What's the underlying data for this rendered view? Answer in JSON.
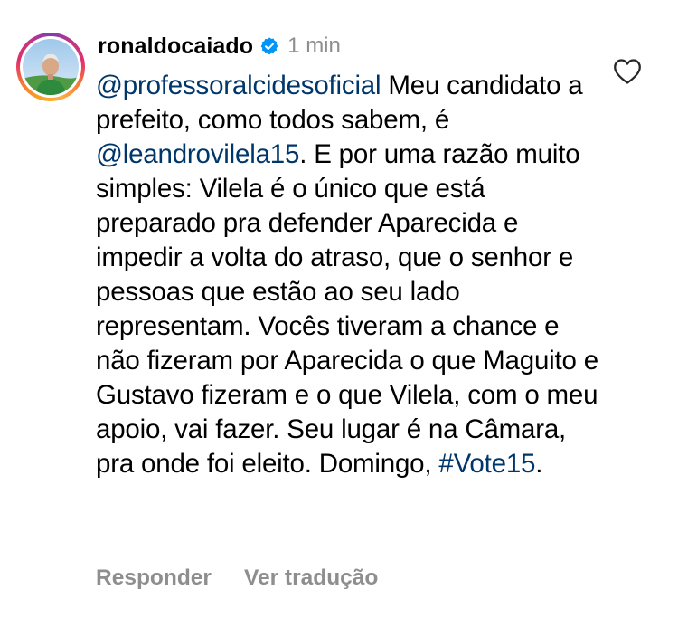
{
  "comment": {
    "username": "ronaldocaiado",
    "verified_icon": "verified-badge-icon",
    "timestamp": "1 min",
    "segments": [
      {
        "type": "mention",
        "text": "@professoralcidesoficial"
      },
      {
        "type": "text",
        "text": " Meu candidato a prefeito, como todos sabem, é "
      },
      {
        "type": "mention",
        "text": "@leandrovilela15"
      },
      {
        "type": "text",
        "text": ". E por uma razão muito simples: Vilela é o único que está preparado pra defender Aparecida e impedir a volta do atraso, que o senhor e pessoas que estão ao seu lado representam. Vocês tiveram a chance e não fizeram por Aparecida o que Maguito e Gustavo fizeram e o que Vilela, com o meu apoio, vai fazer. Seu lugar é na Câmara, pra onde foi eleito. Domingo, "
      },
      {
        "type": "hashtag",
        "text": "#Vote15"
      },
      {
        "type": "text",
        "text": "."
      }
    ],
    "like_icon": "heart-outline-icon"
  },
  "actions": {
    "reply_label": "Responder",
    "translate_label": "Ver tradução"
  },
  "colors": {
    "link": "#00376b",
    "secondary_text": "#8e8e8e",
    "verified_blue": "#0095f6"
  }
}
